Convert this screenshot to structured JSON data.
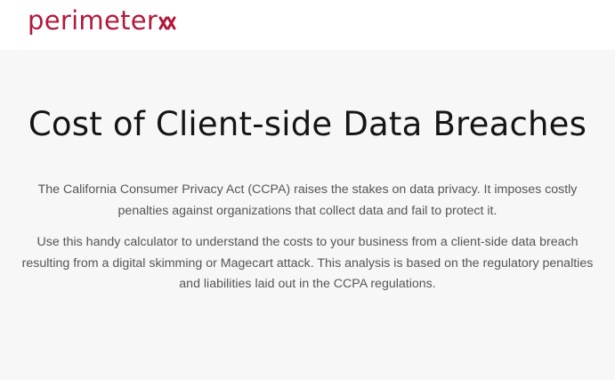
{
  "header": {
    "logo_text": "perimeter",
    "logo_mark_icon": "double-x-icon",
    "brand_color": "#b11a3b"
  },
  "hero": {
    "title": "Cost of Client-side Data Breaches",
    "paragraph_1": "The California Consumer Privacy Act (CCPA) raises the stakes on data privacy. It imposes costly penalties against organizations that collect data and fail to protect it.",
    "paragraph_2": "Use this handy calculator to understand the costs to your business from a client-side data breach resulting from a digital skimming or Magecart attack. This analysis is based on the regulatory penalties and liabilities laid out in the CCPA regulations.",
    "background_color": "#f7f7f7",
    "title_color": "#151515",
    "text_color": "#555555"
  }
}
